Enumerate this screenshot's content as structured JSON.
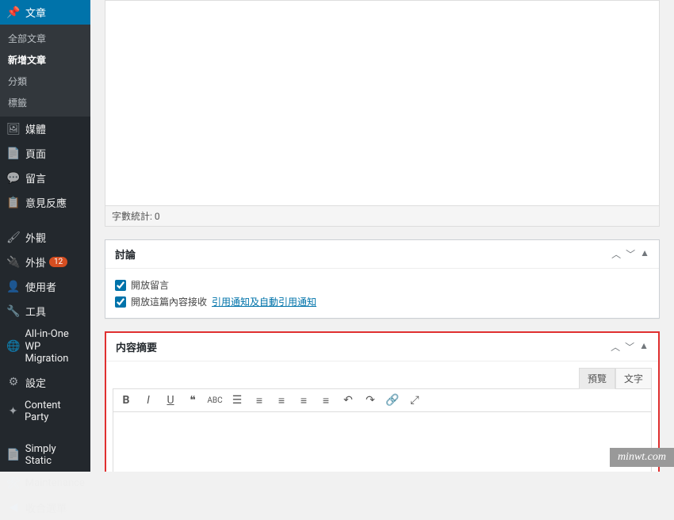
{
  "sidebar": {
    "current": {
      "label": "文章",
      "icon": "📌"
    },
    "submenu": [
      {
        "label": "全部文章",
        "current": false
      },
      {
        "label": "新增文章",
        "current": true
      },
      {
        "label": "分類",
        "current": false
      },
      {
        "label": "標籤",
        "current": false
      }
    ],
    "items": [
      {
        "label": "媒體",
        "icon": "🖼"
      },
      {
        "label": "頁面",
        "icon": "📄"
      },
      {
        "label": "留言",
        "icon": "💬"
      },
      {
        "label": "意見反應",
        "icon": "📋"
      }
    ],
    "items2": [
      {
        "label": "外觀",
        "icon": "🖌"
      },
      {
        "label": "外掛",
        "icon": "🔌",
        "badge": "12"
      },
      {
        "label": "使用者",
        "icon": "👤"
      },
      {
        "label": "工具",
        "icon": "🔧"
      },
      {
        "label": "All-in-One WP Migration",
        "icon": "🌐"
      },
      {
        "label": "設定",
        "icon": "⚙"
      },
      {
        "label": "Content Party",
        "icon": "✦"
      },
      {
        "label": "Simply Static",
        "icon": "📄"
      },
      {
        "label": "Maintenance",
        "icon": "🛠"
      },
      {
        "label": "收合選單",
        "icon": "◀"
      }
    ]
  },
  "editor": {
    "word_count_label": "字數統計:",
    "word_count_value": "0"
  },
  "discussion": {
    "title": "討論",
    "allow_comments": "開放留言",
    "allow_pings_pre": "開放這篇內容接收",
    "allow_pings_link": "引用通知及自動引用通知"
  },
  "excerpt": {
    "title": "内容摘要",
    "tabs": {
      "preview": "預覽",
      "text": "文字"
    }
  },
  "watermark": "minwt.com"
}
